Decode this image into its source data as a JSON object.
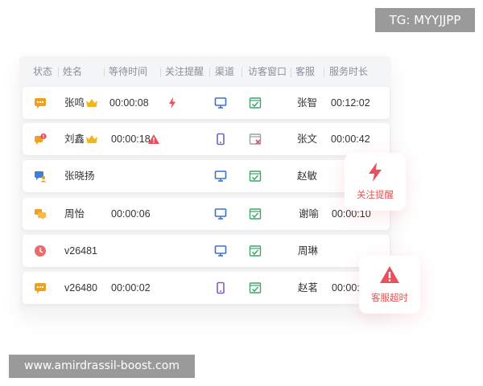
{
  "watermarks": {
    "top": "TG: MYYJJPP",
    "bottom": "www.amirdrassil-boost.com"
  },
  "table": {
    "headers": [
      "状态",
      "姓名",
      "等待时间",
      "关注提醒",
      "渠道",
      "访客窗口",
      "客服",
      "服务时长"
    ],
    "rows": [
      {
        "status_icon": "chat-icon",
        "status_color": "#f0a020",
        "name": "张鸣",
        "vip": true,
        "wait": "00:00:08",
        "alert_icon": "lightning-icon",
        "channel_icon": "monitor-icon",
        "window_icon": "check-window-icon",
        "agent": "张智",
        "duration": "00:12:02"
      },
      {
        "status_icon": "chat-alert-icon",
        "status_color": "#f0a020",
        "name": "刘鑫",
        "vip": true,
        "wait": "00:00:18",
        "alert_icon": "warning-icon",
        "channel_icon": "mobile-icon",
        "window_icon": "closed-window-icon",
        "agent": "张文",
        "duration": "00:00:42"
      },
      {
        "status_icon": "transfer-chat-icon",
        "status_color": "#3f7fd6",
        "name": "张晓扬",
        "vip": false,
        "wait": "",
        "alert_icon": "",
        "channel_icon": "monitor-icon",
        "window_icon": "check-window-icon",
        "agent": "赵敏",
        "duration": ""
      },
      {
        "status_icon": "chat-icon",
        "status_color": "#f0a020",
        "name": "周怡",
        "vip": false,
        "wait": "00:00:06",
        "alert_icon": "",
        "channel_icon": "monitor-icon",
        "window_icon": "check-window-icon",
        "agent": "谢喻",
        "duration": "00:00:10"
      },
      {
        "status_icon": "clock-icon",
        "status_color": "#ee6a6a",
        "name": "v26481",
        "vip": false,
        "wait": "",
        "alert_icon": "",
        "channel_icon": "monitor-icon",
        "window_icon": "check-window-icon",
        "agent": "周琳",
        "duration": ""
      },
      {
        "status_icon": "chat-icon",
        "status_color": "#f0a020",
        "name": "v26480",
        "vip": false,
        "wait": "00:00:02",
        "alert_icon": "",
        "channel_icon": "mobile-icon",
        "window_icon": "check-window-icon",
        "agent": "赵茗",
        "duration": "00:00:"
      }
    ]
  },
  "floating": {
    "attention": {
      "label": "关注提醒",
      "icon": "lightning-icon"
    },
    "overtime": {
      "label": "客服超时",
      "icon": "warning-icon"
    }
  },
  "colors": {
    "accent_red": "#e05454",
    "monitor_blue": "#3a72c8",
    "mobile_purple": "#7b5ec4",
    "check_green": "#3fa36a",
    "crown_gold": "#f2b51a"
  }
}
